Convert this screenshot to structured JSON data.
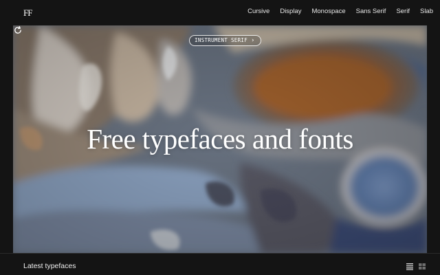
{
  "header": {
    "logo": "FF",
    "nav": [
      "Cursive",
      "Display",
      "Monospace",
      "Sans Serif",
      "Serif",
      "Slab"
    ]
  },
  "hero": {
    "font_tag": "INSTRUMENT SERIF",
    "font_tag_icon": "chevron-right-icon",
    "title": "Free typefaces and fonts",
    "refresh_icon": "refresh-icon"
  },
  "footer": {
    "section_title": "Latest typefaces",
    "view_icons": [
      "list-view-icon",
      "grid-view-icon"
    ]
  }
}
